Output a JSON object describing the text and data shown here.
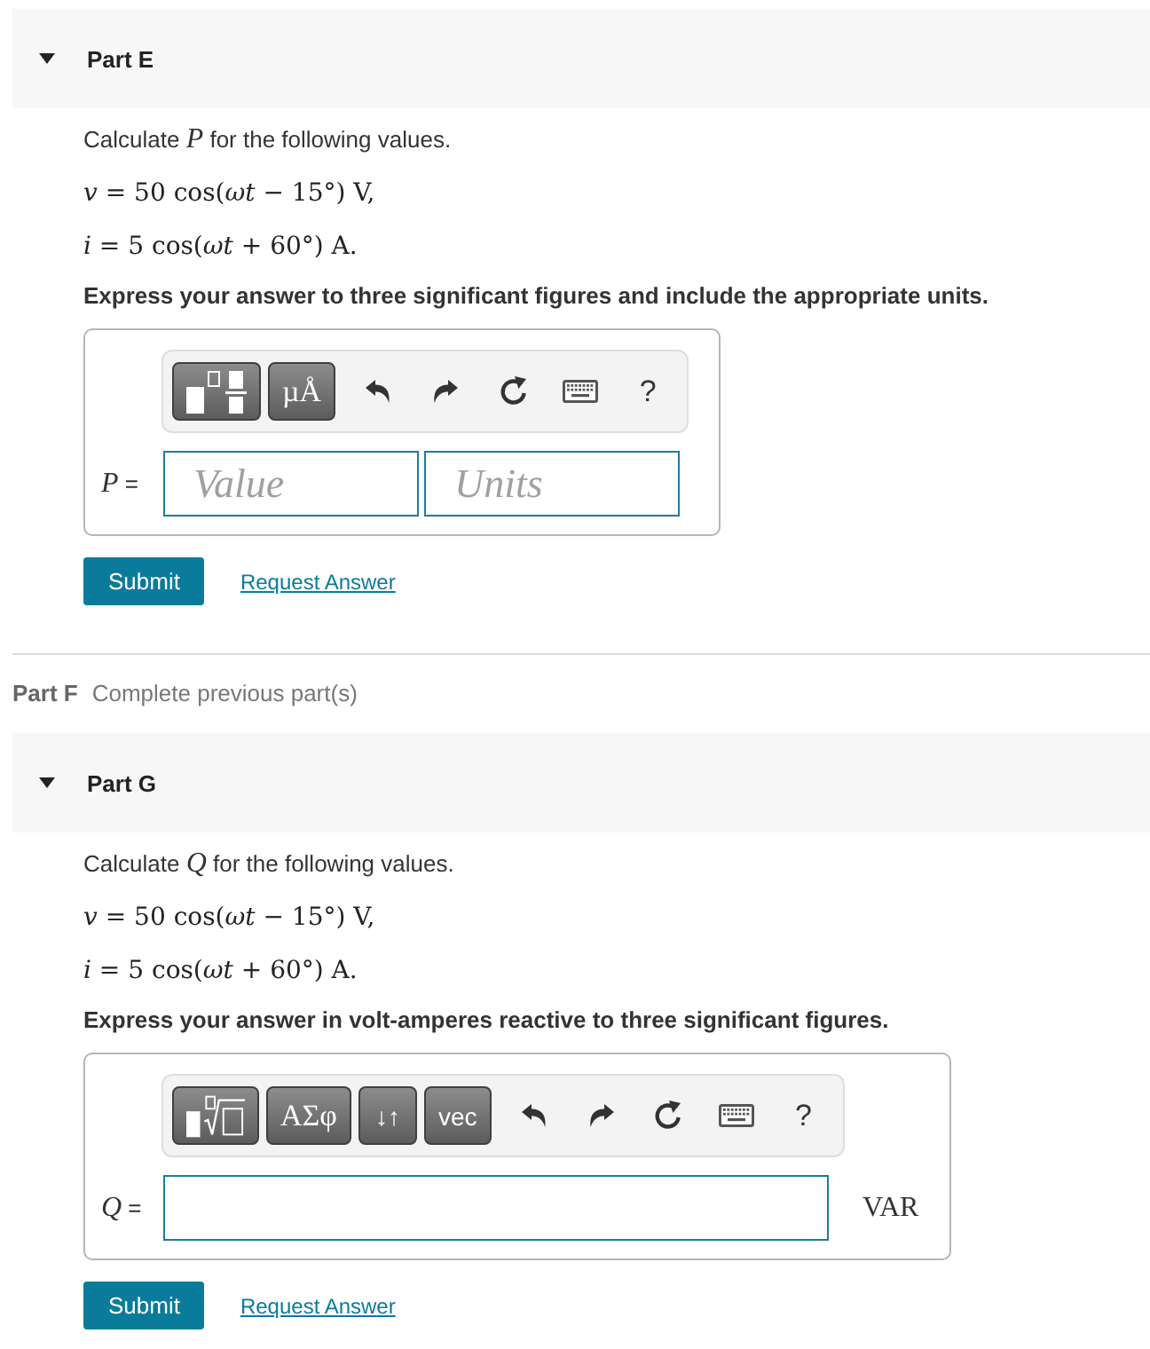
{
  "parts": [
    {
      "kind": "question",
      "title": "Part E",
      "expanded": true,
      "prompt": "Calculate *P* for the following values.",
      "equations": [
        "*v* = 50 cos(*ωt* − 15°) V,",
        "*i* = 5 cos(*ωt* + 60°) A."
      ],
      "instruction": "Express your answer to three significant figures and include the appropriate units.",
      "answer": {
        "kind": "value-units",
        "label": "*P* =",
        "toolbar": {
          "buttons": [
            {
              "kind": "power-fraction"
            },
            {
              "kind": "symbols",
              "label": "µÅ"
            }
          ],
          "help": "?"
        },
        "fields": [
          {
            "placeholder": "Value"
          },
          {
            "placeholder": "Units"
          }
        ]
      },
      "submit": "Submit",
      "request": "Request Answer"
    },
    {
      "kind": "locked",
      "title": "Part F",
      "note": "Complete previous part(s)"
    },
    {
      "kind": "question",
      "title": "Part G",
      "expanded": true,
      "prompt": "Calculate *Q* for the following values.",
      "equations": [
        "*v* = 50 cos(*ωt* − 15°) V,",
        "*i* = 5 cos(*ωt* + 60°) A."
      ],
      "instruction": "Express your answer in volt-amperes reactive to three significant figures.",
      "answer": {
        "kind": "value",
        "label": "*Q* =",
        "toolbar": {
          "buttons": [
            {
              "kind": "root"
            },
            {
              "kind": "symbols",
              "label": "ΑΣφ"
            },
            {
              "kind": "label",
              "label": "↓↑"
            },
            {
              "kind": "label",
              "label": "vec"
            }
          ],
          "help": "?"
        },
        "unit": "VAR"
      },
      "submit": "Submit",
      "request": "Request Answer"
    }
  ]
}
